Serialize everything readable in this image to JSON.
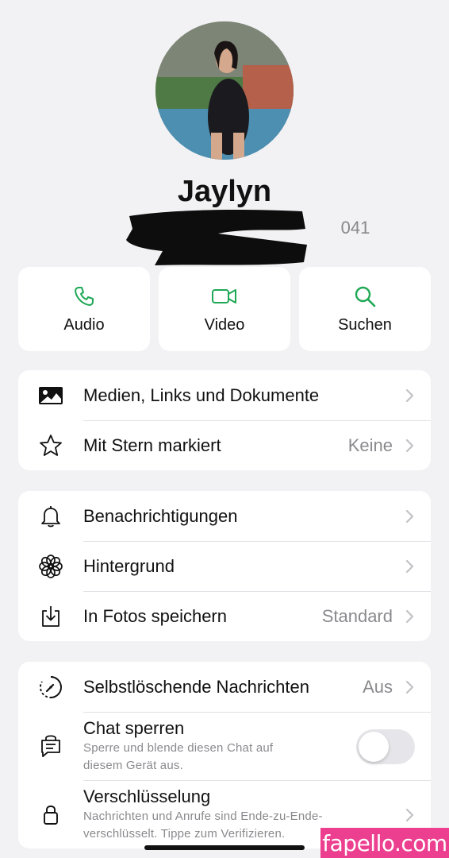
{
  "contact": {
    "name": "Jaylyn",
    "phone_visible_fragment": "041"
  },
  "actions": [
    {
      "label": "Audio",
      "icon": "phone-icon"
    },
    {
      "label": "Video",
      "icon": "video-camera-icon"
    },
    {
      "label": "Suchen",
      "icon": "search-icon"
    }
  ],
  "group1": [
    {
      "label": "Medien, Links und Dokumente",
      "value": "",
      "icon": "photo-icon"
    },
    {
      "label": "Mit Stern markiert",
      "value": "Keine",
      "icon": "star-icon"
    }
  ],
  "group2": [
    {
      "label": "Benachrichtigungen",
      "value": "",
      "icon": "bell-icon"
    },
    {
      "label": "Hintergrund",
      "value": "",
      "icon": "flower-icon"
    },
    {
      "label": "In Fotos speichern",
      "value": "Standard",
      "icon": "download-icon"
    }
  ],
  "group3": {
    "disappearing": {
      "label": "Selbstlöschende Nachrichten",
      "value": "Aus",
      "icon": "timer-icon"
    },
    "lock_chat": {
      "label": "Chat sperren",
      "sub_line1": "Sperre und blende diesen Chat auf",
      "sub_line2": "diesem Gerät aus.",
      "enabled": false,
      "icon": "chat-lock-icon"
    },
    "encryption": {
      "label": "Verschlüsselung",
      "sub_line1": "Nachrichten und Anrufe sind Ende-zu-Ende-",
      "sub_line2": "verschlüsselt. Tippe zum Verifizieren.",
      "icon": "lock-icon"
    }
  },
  "watermark": "fapello.com",
  "colors": {
    "accent_green": "#1fa855",
    "background": "#f2f2f4",
    "card": "#ffffff",
    "secondary_text": "#8a8a8e",
    "watermark_bg": "#ec3f8f"
  }
}
